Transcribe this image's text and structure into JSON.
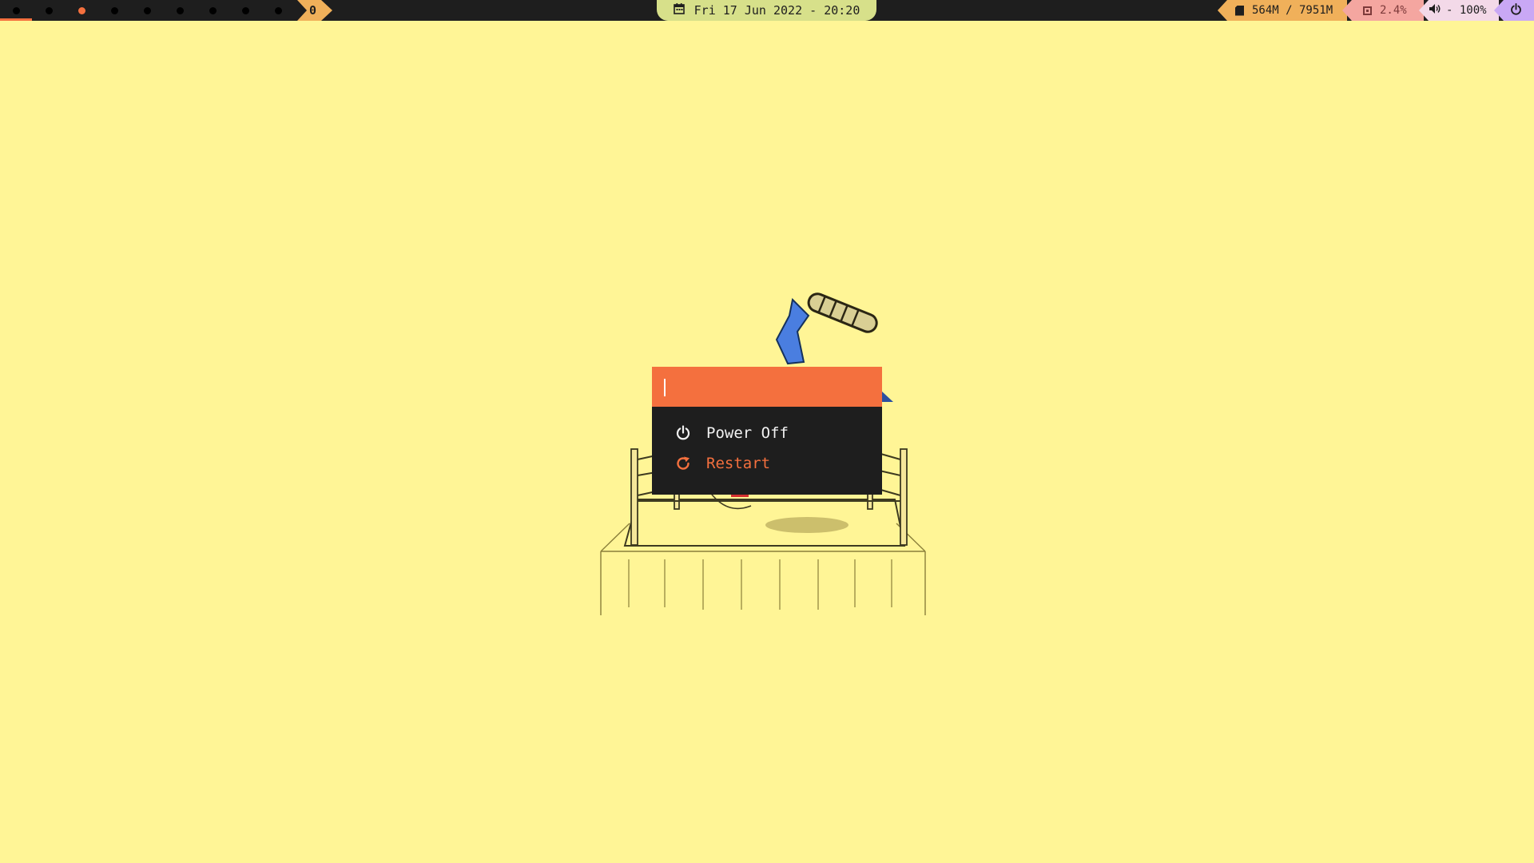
{
  "topbar": {
    "workspaces": [
      {
        "id": "1",
        "active": false,
        "underlined": true
      },
      {
        "id": "2",
        "active": false,
        "underlined": false
      },
      {
        "id": "3",
        "active": true,
        "underlined": false
      },
      {
        "id": "4",
        "active": false,
        "underlined": false
      },
      {
        "id": "5",
        "active": false,
        "underlined": false
      },
      {
        "id": "6",
        "active": false,
        "underlined": false
      },
      {
        "id": "7",
        "active": false,
        "underlined": false
      },
      {
        "id": "8",
        "active": false,
        "underlined": false
      },
      {
        "id": "9",
        "active": false,
        "underlined": false
      }
    ],
    "layout_label": "0",
    "clock": {
      "icon": "calendar-icon",
      "text": "Fri 17 Jun 2022 - 20:20"
    },
    "memory": {
      "icon": "sd-card-icon",
      "text": "564M / 7951M"
    },
    "cpu": {
      "icon": "cpu-icon",
      "text": "2.4%"
    },
    "volume": {
      "icon": "speaker-icon",
      "text": "- 100%"
    },
    "power": {
      "icon": "power-icon"
    }
  },
  "launcher": {
    "prompt_value": "",
    "items": [
      {
        "label": "Power Off",
        "icon": "power-icon",
        "selected": false
      },
      {
        "label": "Restart",
        "icon": "refresh-icon",
        "selected": true
      }
    ]
  },
  "colors": {
    "accent": "#f4703e",
    "wallpaper": "#fff596",
    "bar": "#1e1e1e",
    "launcher_bg": "#1e1e1e"
  }
}
